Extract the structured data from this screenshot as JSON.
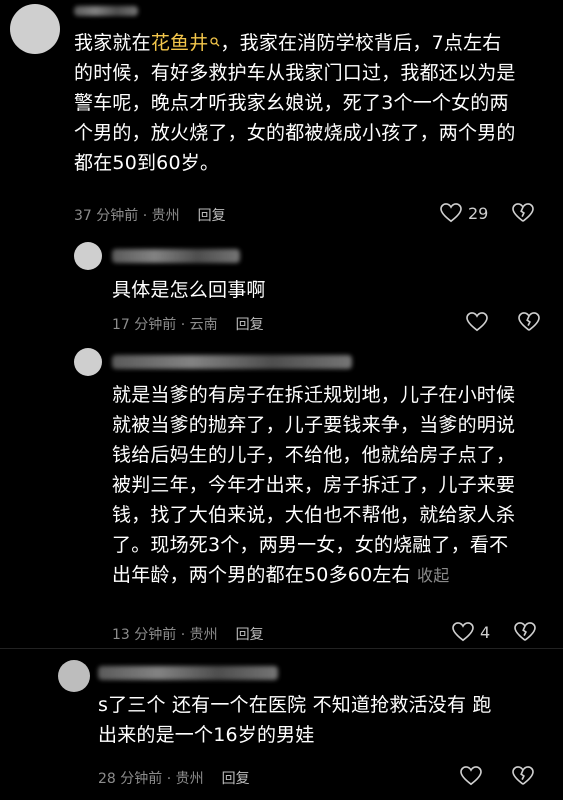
{
  "comments": [
    {
      "name_blurred": true,
      "text_before_highlight": "我家就在",
      "highlight": "花鱼井",
      "highlight_icon": "search-icon",
      "text_after_highlight": "，我家在消防学校背后，7点左右\n的时候，有好多救护车从我家门口过，我都还以为是\n警车呢，晚点才听我家幺娘说，死了3个一个女的两\n个男的，放火烧了，女的都被烧成小孩了，两个男的\n都在50到60岁。",
      "time": "37 分钟前",
      "location": "贵州",
      "reply": "回复",
      "likes": "29"
    },
    {
      "name_blurred": true,
      "text": "具体是怎么回事啊",
      "time": "17 分钟前",
      "location": "云南",
      "reply": "回复",
      "likes": ""
    },
    {
      "name_blurred": true,
      "text": "就是当爹的有房子在拆迁规划地，儿子在小时候\n就被当爹的抛弃了，儿子要钱来争，当爹的明说\n钱给后妈生的儿子，不给他，他就给房子点了，\n被判三年，今年才出来，房子拆迁了，儿子来要\n钱，找了大伯来说，大伯也不帮他，就给家人杀\n了。现场死3个，两男一女，女的烧融了，看不\n出年龄，两个男的都在50多60左右",
      "fold": "收起",
      "time": "13 分钟前",
      "location": "贵州",
      "reply": "回复",
      "likes": "4"
    },
    {
      "name_blurred": true,
      "text": "s了三个 还有一个在医院 不知道抢救活没有 跑\n出来的是一个16岁的男娃",
      "time": "28 分钟前",
      "location": "贵州",
      "reply": "回复",
      "likes": ""
    }
  ],
  "separator": "·"
}
